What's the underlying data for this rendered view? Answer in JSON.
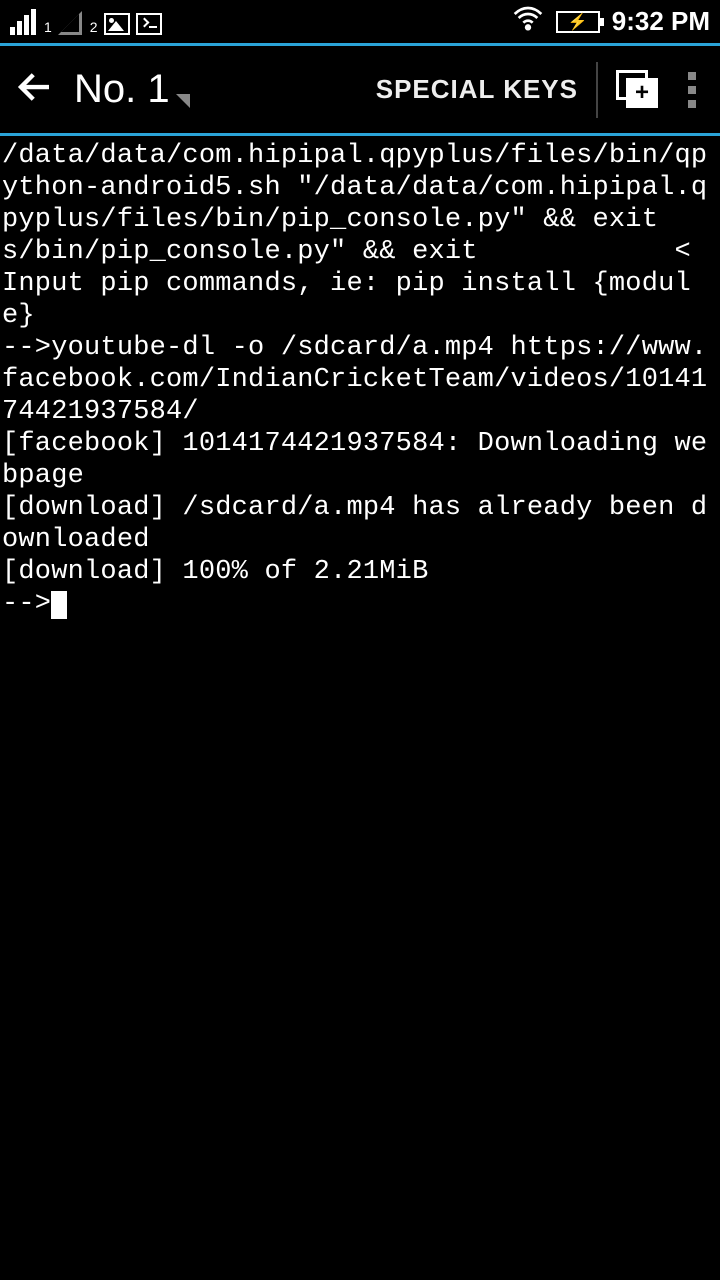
{
  "status": {
    "sim1_sub": "1",
    "sim2_sub": "2",
    "time": "9:32 PM"
  },
  "appbar": {
    "session_label": "No. 1",
    "special_keys": "SPECIAL KEYS",
    "newwin_plus": "+"
  },
  "terminal": {
    "line1": "/data/data/com.hipipal.qpyplus/files/bin/qpython-android5.sh \"/data/data/com.hipipal.qpyplus/files/bin/pip_console.py\" && exit",
    "line2": "s/bin/pip_console.py\" && exit            <",
    "line3": "Input pip commands, ie: pip install {module}",
    "line4": "-->youtube-dl -o /sdcard/a.mp4 https://www.facebook.com/IndianCricketTeam/videos/1014174421937584/",
    "line5": "[facebook] 1014174421937584: Downloading webpage",
    "line6": "[download] /sdcard/a.mp4 has already been downloaded",
    "line7": "[download] 100% of 2.21MiB",
    "prompt": "-->"
  }
}
